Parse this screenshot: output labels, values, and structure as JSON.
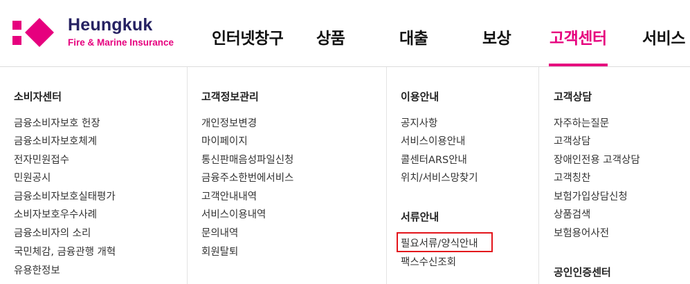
{
  "logo": {
    "name": "Heungkuk",
    "tagline": "Fire & Marine Insurance"
  },
  "nav": [
    {
      "label": "인터넷창구"
    },
    {
      "label": "상품"
    },
    {
      "label": "대출"
    },
    {
      "label": "보상"
    },
    {
      "label": "고객센터",
      "active": true
    },
    {
      "label": "서비스"
    }
  ],
  "colors": {
    "brand": "#e6007e",
    "navy": "#262262",
    "highlight": "#e3141b"
  },
  "menu": {
    "col1": {
      "title": "소비자센터",
      "items": [
        "금융소비자보호 헌장",
        "금융소비자보호체계",
        "전자민원접수",
        "민원공시",
        "금융소비자보호실태평가",
        "소비자보호우수사례",
        "금융소비자의 소리",
        "국민체감, 금융관행 개혁",
        "유용한정보"
      ]
    },
    "col2": {
      "title": "고객정보관리",
      "items": [
        "개인정보변경",
        "마이페이지",
        "통신판매음성파일신청",
        "금융주소한번에서비스",
        "고객안내내역",
        "서비스이용내역",
        "문의내역",
        "회원탈퇴"
      ]
    },
    "col3": {
      "title": "이용안내",
      "items": [
        "공지사항",
        "서비스이용안내",
        "콜센터ARS안내",
        "위치/서비스망찾기"
      ],
      "title2": "서류안내",
      "items2": [
        "필요서류/양식안내",
        "팩스수신조회"
      ]
    },
    "col4": {
      "title": "고객상담",
      "items": [
        "자주하는질문",
        "고객상담",
        "장애인전용 고객상담",
        "고객칭찬",
        "보험가입상담신청",
        "상품검색",
        "보험용어사전"
      ],
      "title2": "공인인증센터"
    }
  }
}
